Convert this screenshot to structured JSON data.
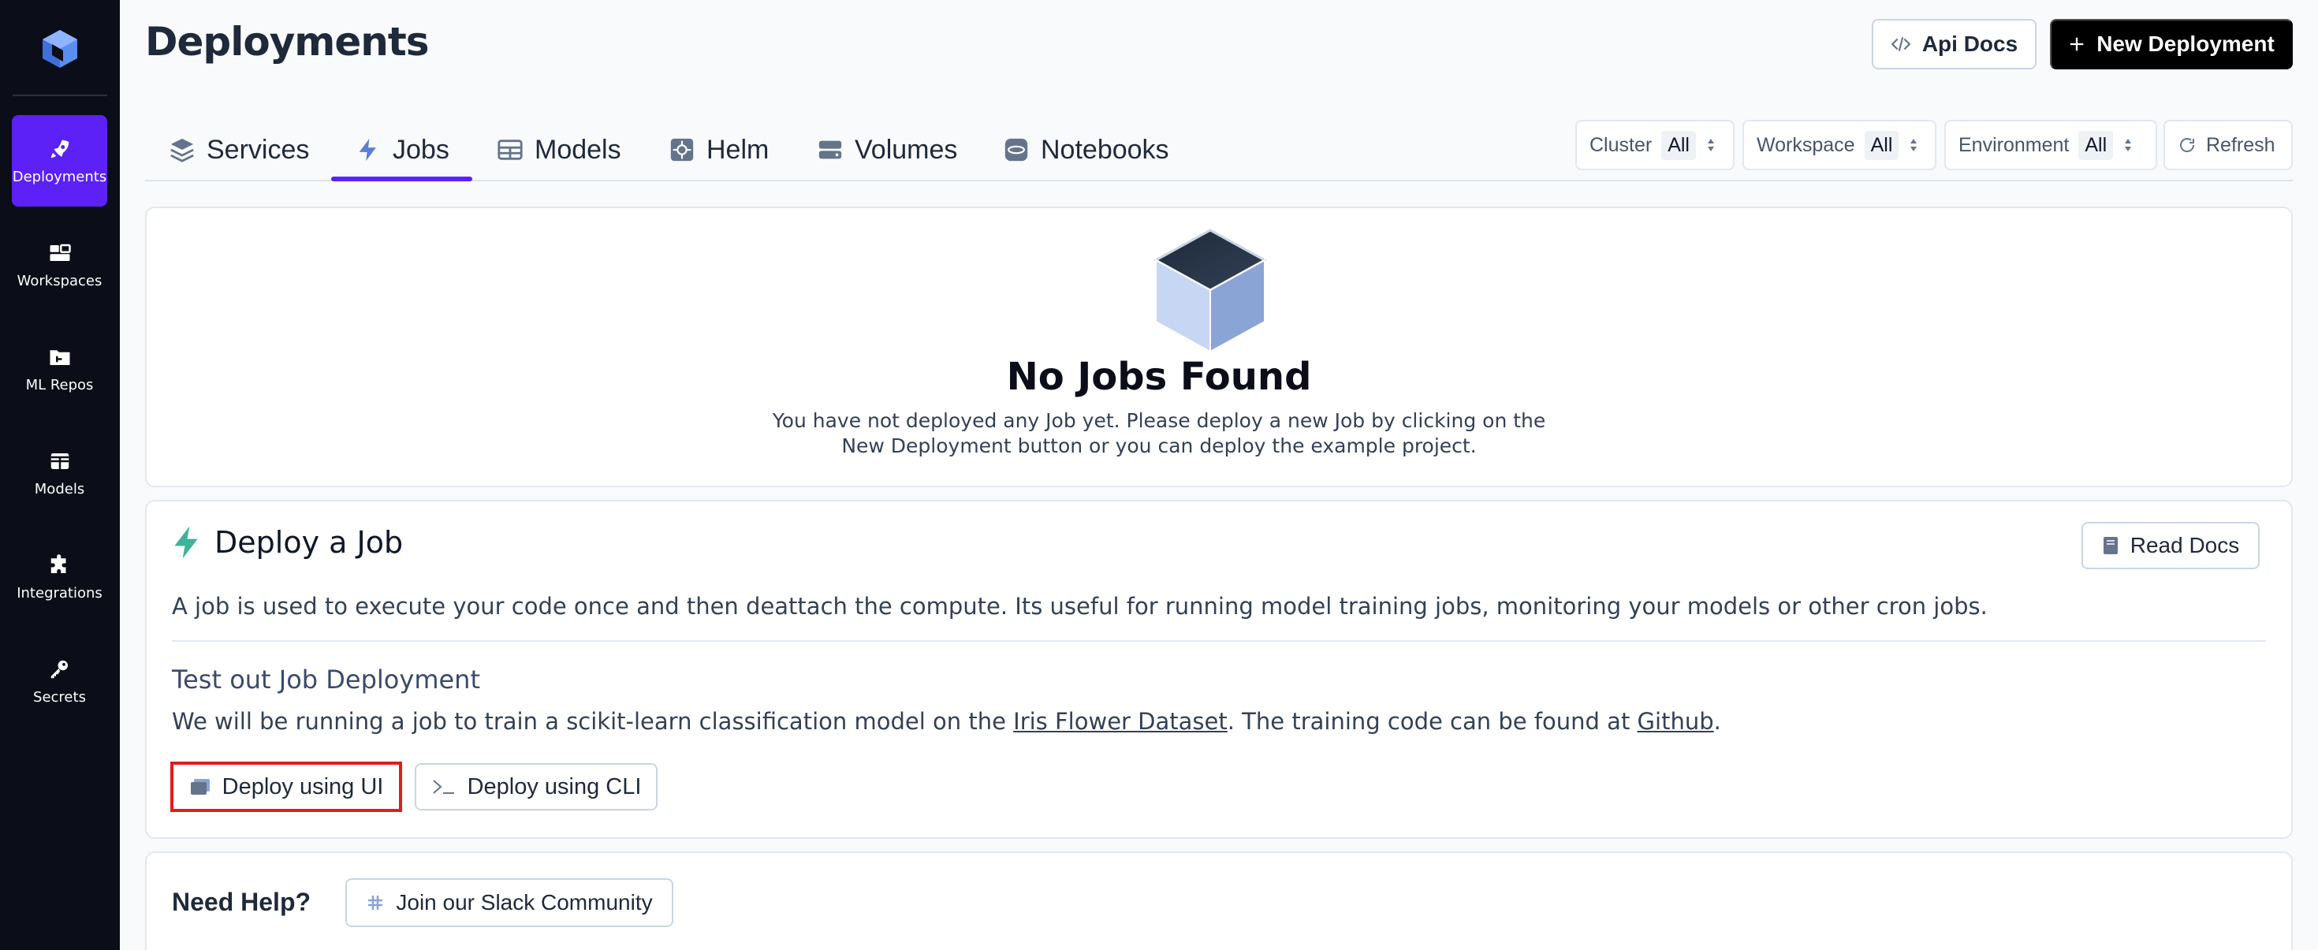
{
  "sidebar": {
    "logo_icon": "cube-logo-icon",
    "items": [
      {
        "label": "Deployments",
        "icon": "rocket-icon",
        "active": true
      },
      {
        "label": "Workspaces",
        "icon": "workspaces-icon",
        "active": false
      },
      {
        "label": "ML Repos",
        "icon": "folder-git-icon",
        "active": false
      },
      {
        "label": "Models",
        "icon": "table-icon",
        "active": false
      },
      {
        "label": "Integrations",
        "icon": "puzzle-icon",
        "active": false
      },
      {
        "label": "Secrets",
        "icon": "key-icon",
        "active": false
      }
    ]
  },
  "header": {
    "title": "Deployments",
    "api_docs_label": "Api Docs",
    "new_deployment_label": "New Deployment"
  },
  "tabs": [
    {
      "label": "Services",
      "icon": "layers-icon"
    },
    {
      "label": "Jobs",
      "icon": "bolt-icon",
      "active": true
    },
    {
      "label": "Models",
      "icon": "table-icon"
    },
    {
      "label": "Helm",
      "icon": "helm-icon"
    },
    {
      "label": "Volumes",
      "icon": "volumes-icon"
    },
    {
      "label": "Notebooks",
      "icon": "notebook-icon"
    }
  ],
  "filters": {
    "cluster": {
      "label": "Cluster",
      "value": "All"
    },
    "workspace": {
      "label": "Workspace",
      "value": "All"
    },
    "environment": {
      "label": "Environment",
      "value": "All"
    },
    "refresh_label": "Refresh"
  },
  "empty_state": {
    "title": "No Jobs Found",
    "line1": "You have not deployed any Job yet. Please deploy a new Job by clicking on the",
    "line2": "New Deployment button or you can deploy the example project."
  },
  "deploy_section": {
    "title": "Deploy a Job",
    "read_docs_label": "Read Docs",
    "description": "A job is used to execute your code once and then deattach the compute. Its useful for running model training jobs, monitoring your models or other cron jobs.",
    "test_title": "Test out Job Deployment",
    "test_desc_before": "We will be running a job to train a scikit-learn classification model on the ",
    "test_link_dataset": "Iris Flower Dataset",
    "test_desc_middle": ". The training code can be found at ",
    "test_link_github": "Github",
    "test_desc_after": ".",
    "deploy_ui_label": "Deploy using UI",
    "deploy_cli_label": "Deploy using CLI"
  },
  "help": {
    "title": "Need Help?",
    "slack_label": "Join our Slack Community"
  },
  "colors": {
    "accent": "#5b21f6",
    "sidebar_bg": "#0b0d18",
    "highlight_border": "#e11d1d",
    "bolt_green": "#3fb39a"
  }
}
